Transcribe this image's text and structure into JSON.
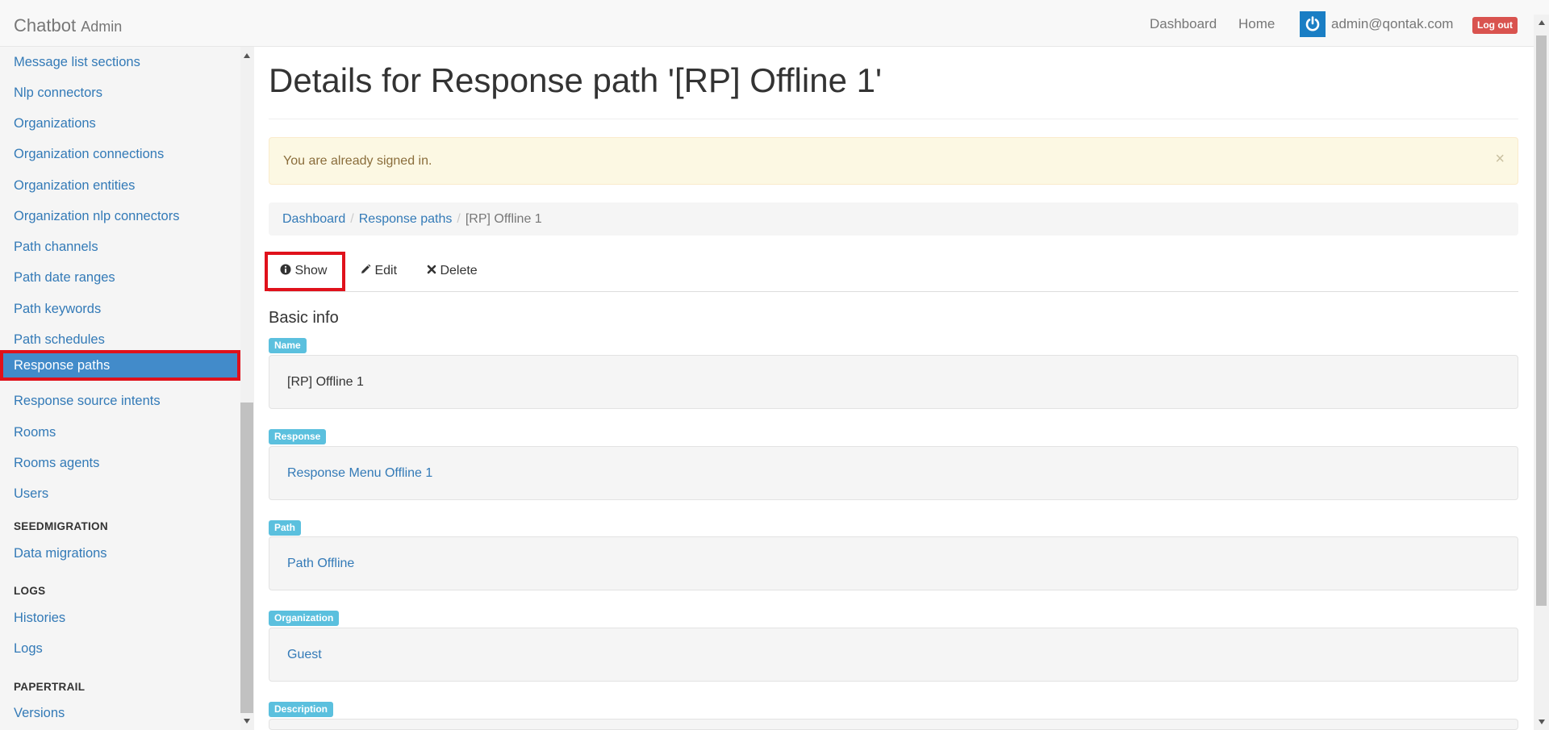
{
  "navbar": {
    "brand": "Chatbot",
    "brand_sub": "Admin",
    "links": [
      "Dashboard",
      "Home"
    ],
    "user_email": "admin@qontak.com",
    "logout": "Log out"
  },
  "sidebar": {
    "items": [
      "Message list sections",
      "Nlp connectors",
      "Organizations",
      "Organization connections",
      "Organization entities",
      "Organization nlp connectors",
      "Path channels",
      "Path date ranges",
      "Path keywords",
      "Path schedules",
      "Response paths",
      "Response source intents",
      "Rooms",
      "Rooms agents",
      "Users"
    ],
    "active_item": "Response paths",
    "sections": [
      {
        "header": "SEEDMIGRATION",
        "items": [
          "Data migrations"
        ]
      },
      {
        "header": "LOGS",
        "items": [
          "Histories",
          "Logs"
        ]
      },
      {
        "header": "PAPERTRAIL",
        "items": [
          "Versions"
        ]
      }
    ]
  },
  "main": {
    "title": "Details for Response path '[RP] Offline 1'",
    "alert": "You are already signed in.",
    "alert_close": "×",
    "breadcrumb": {
      "items": [
        "Dashboard",
        "Response paths"
      ],
      "current": "[RP] Offline 1"
    },
    "tabs": {
      "show": "Show",
      "edit": "Edit",
      "delete": "Delete"
    },
    "section_title": "Basic info",
    "fields": [
      {
        "label": "Name",
        "value": "[RP] Offline 1",
        "is_link": false
      },
      {
        "label": "Response",
        "value": "Response Menu Offline 1",
        "is_link": true
      },
      {
        "label": "Path",
        "value": "Path Offline",
        "is_link": true
      },
      {
        "label": "Organization",
        "value": "Guest",
        "is_link": true
      },
      {
        "label": "Description",
        "value": "",
        "is_link": false
      }
    ]
  },
  "colors": {
    "link": "#337ab7",
    "active": "#428bca",
    "highlight": "#e0111b",
    "label": "#5bc0de",
    "danger": "#d9534f"
  }
}
